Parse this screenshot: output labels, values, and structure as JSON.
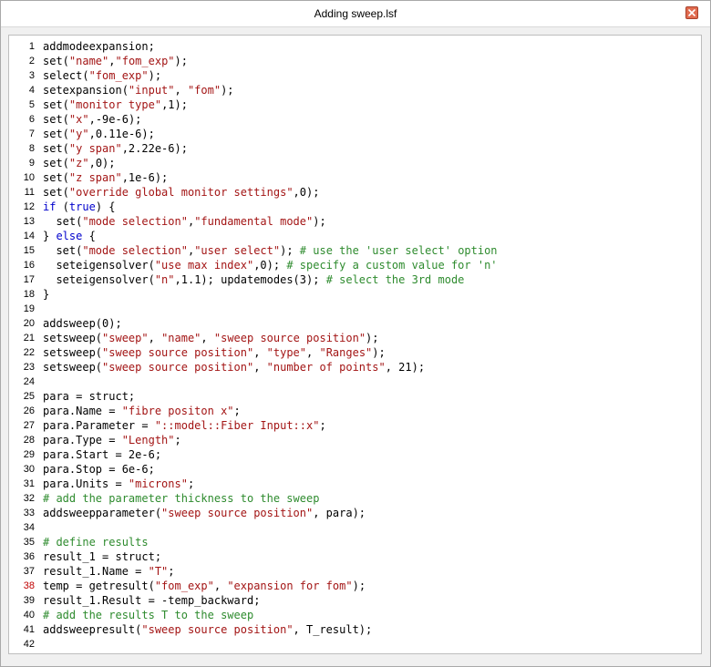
{
  "window": {
    "title": "Adding sweep.lsf"
  },
  "icons": {
    "close": "close-icon"
  },
  "colors": {
    "keyword": "#0000cc",
    "string": "#a31515",
    "comment": "#2e8b2e",
    "text": "#000000",
    "highlighted_line_number": "#c00000"
  },
  "editor": {
    "highlighted_line": 38,
    "lines": [
      {
        "n": "1",
        "tokens": [
          {
            "c": "t",
            "v": "addmodeexpansion;"
          }
        ]
      },
      {
        "n": "2",
        "tokens": [
          {
            "c": "t",
            "v": "set("
          },
          {
            "c": "str",
            "v": "\"name\""
          },
          {
            "c": "t",
            "v": ","
          },
          {
            "c": "str",
            "v": "\"fom_exp\""
          },
          {
            "c": "t",
            "v": ");"
          }
        ]
      },
      {
        "n": "3",
        "tokens": [
          {
            "c": "t",
            "v": "select("
          },
          {
            "c": "str",
            "v": "\"fom_exp\""
          },
          {
            "c": "t",
            "v": ");"
          }
        ]
      },
      {
        "n": "4",
        "tokens": [
          {
            "c": "t",
            "v": "setexpansion("
          },
          {
            "c": "str",
            "v": "\"input\""
          },
          {
            "c": "t",
            "v": ", "
          },
          {
            "c": "str",
            "v": "\"fom\""
          },
          {
            "c": "t",
            "v": ");"
          }
        ]
      },
      {
        "n": "5",
        "tokens": [
          {
            "c": "t",
            "v": "set("
          },
          {
            "c": "str",
            "v": "\"monitor type\""
          },
          {
            "c": "t",
            "v": ",1);"
          }
        ]
      },
      {
        "n": "6",
        "tokens": [
          {
            "c": "t",
            "v": "set("
          },
          {
            "c": "str",
            "v": "\"x\""
          },
          {
            "c": "t",
            "v": ",-9e-6);"
          }
        ]
      },
      {
        "n": "7",
        "tokens": [
          {
            "c": "t",
            "v": "set("
          },
          {
            "c": "str",
            "v": "\"y\""
          },
          {
            "c": "t",
            "v": ",0.11e-6);"
          }
        ]
      },
      {
        "n": "8",
        "tokens": [
          {
            "c": "t",
            "v": "set("
          },
          {
            "c": "str",
            "v": "\"y span\""
          },
          {
            "c": "t",
            "v": ",2.22e-6);"
          }
        ]
      },
      {
        "n": "9",
        "tokens": [
          {
            "c": "t",
            "v": "set("
          },
          {
            "c": "str",
            "v": "\"z\""
          },
          {
            "c": "t",
            "v": ",0);"
          }
        ]
      },
      {
        "n": "10",
        "tokens": [
          {
            "c": "t",
            "v": "set("
          },
          {
            "c": "str",
            "v": "\"z span\""
          },
          {
            "c": "t",
            "v": ",1e-6);"
          }
        ]
      },
      {
        "n": "11",
        "tokens": [
          {
            "c": "t",
            "v": "set("
          },
          {
            "c": "str",
            "v": "\"override global monitor settings\""
          },
          {
            "c": "t",
            "v": ",0);"
          }
        ]
      },
      {
        "n": "12",
        "tokens": [
          {
            "c": "kw",
            "v": "if"
          },
          {
            "c": "t",
            "v": " ("
          },
          {
            "c": "kw",
            "v": "true"
          },
          {
            "c": "t",
            "v": ") {"
          }
        ]
      },
      {
        "n": "13",
        "tokens": [
          {
            "c": "t",
            "v": "  set("
          },
          {
            "c": "str",
            "v": "\"mode selection\""
          },
          {
            "c": "t",
            "v": ","
          },
          {
            "c": "str",
            "v": "\"fundamental mode\""
          },
          {
            "c": "t",
            "v": ");"
          }
        ]
      },
      {
        "n": "14",
        "tokens": [
          {
            "c": "t",
            "v": "} "
          },
          {
            "c": "kw",
            "v": "else"
          },
          {
            "c": "t",
            "v": " {"
          }
        ]
      },
      {
        "n": "15",
        "tokens": [
          {
            "c": "t",
            "v": "  set("
          },
          {
            "c": "str",
            "v": "\"mode selection\""
          },
          {
            "c": "t",
            "v": ","
          },
          {
            "c": "str",
            "v": "\"user select\""
          },
          {
            "c": "t",
            "v": "); "
          },
          {
            "c": "cm",
            "v": "# use the 'user select' option"
          }
        ]
      },
      {
        "n": "16",
        "tokens": [
          {
            "c": "t",
            "v": "  seteigensolver("
          },
          {
            "c": "str",
            "v": "\"use max index\""
          },
          {
            "c": "t",
            "v": ",0); "
          },
          {
            "c": "cm",
            "v": "# specify a custom value for 'n'"
          }
        ]
      },
      {
        "n": "17",
        "tokens": [
          {
            "c": "t",
            "v": "  seteigensolver("
          },
          {
            "c": "str",
            "v": "\"n\""
          },
          {
            "c": "t",
            "v": ",1.1); updatemodes(3); "
          },
          {
            "c": "cm",
            "v": "# select the 3rd mode"
          }
        ]
      },
      {
        "n": "18",
        "tokens": [
          {
            "c": "t",
            "v": "}"
          }
        ]
      },
      {
        "n": "19",
        "tokens": []
      },
      {
        "n": "20",
        "tokens": [
          {
            "c": "t",
            "v": "addsweep(0);"
          }
        ]
      },
      {
        "n": "21",
        "tokens": [
          {
            "c": "t",
            "v": "setsweep("
          },
          {
            "c": "str",
            "v": "\"sweep\""
          },
          {
            "c": "t",
            "v": ", "
          },
          {
            "c": "str",
            "v": "\"name\""
          },
          {
            "c": "t",
            "v": ", "
          },
          {
            "c": "str",
            "v": "\"sweep source position\""
          },
          {
            "c": "t",
            "v": ");"
          }
        ]
      },
      {
        "n": "22",
        "tokens": [
          {
            "c": "t",
            "v": "setsweep("
          },
          {
            "c": "str",
            "v": "\"sweep source position\""
          },
          {
            "c": "t",
            "v": ", "
          },
          {
            "c": "str",
            "v": "\"type\""
          },
          {
            "c": "t",
            "v": ", "
          },
          {
            "c": "str",
            "v": "\"Ranges\""
          },
          {
            "c": "t",
            "v": ");"
          }
        ]
      },
      {
        "n": "23",
        "tokens": [
          {
            "c": "t",
            "v": "setsweep("
          },
          {
            "c": "str",
            "v": "\"sweep source position\""
          },
          {
            "c": "t",
            "v": ", "
          },
          {
            "c": "str",
            "v": "\"number of points\""
          },
          {
            "c": "t",
            "v": ", 21);"
          }
        ]
      },
      {
        "n": "24",
        "tokens": []
      },
      {
        "n": "25",
        "tokens": [
          {
            "c": "t",
            "v": "para = struct;"
          }
        ]
      },
      {
        "n": "26",
        "tokens": [
          {
            "c": "t",
            "v": "para.Name = "
          },
          {
            "c": "str",
            "v": "\"fibre positon x\""
          },
          {
            "c": "t",
            "v": ";"
          }
        ]
      },
      {
        "n": "27",
        "tokens": [
          {
            "c": "t",
            "v": "para.Parameter = "
          },
          {
            "c": "str",
            "v": "\"::model::Fiber Input::x\""
          },
          {
            "c": "t",
            "v": ";"
          }
        ]
      },
      {
        "n": "28",
        "tokens": [
          {
            "c": "t",
            "v": "para.Type = "
          },
          {
            "c": "str",
            "v": "\"Length\""
          },
          {
            "c": "t",
            "v": ";"
          }
        ]
      },
      {
        "n": "29",
        "tokens": [
          {
            "c": "t",
            "v": "para.Start = 2e-6;"
          }
        ]
      },
      {
        "n": "30",
        "tokens": [
          {
            "c": "t",
            "v": "para.Stop = 6e-6;"
          }
        ]
      },
      {
        "n": "31",
        "tokens": [
          {
            "c": "t",
            "v": "para.Units = "
          },
          {
            "c": "str",
            "v": "\"microns\""
          },
          {
            "c": "t",
            "v": ";"
          }
        ]
      },
      {
        "n": "32",
        "tokens": [
          {
            "c": "cm",
            "v": "# add the parameter thickness to the sweep"
          }
        ]
      },
      {
        "n": "33",
        "tokens": [
          {
            "c": "t",
            "v": "addsweepparameter("
          },
          {
            "c": "str",
            "v": "\"sweep source position\""
          },
          {
            "c": "t",
            "v": ", para);"
          }
        ]
      },
      {
        "n": "34",
        "tokens": []
      },
      {
        "n": "35",
        "tokens": [
          {
            "c": "cm",
            "v": "# define results"
          }
        ]
      },
      {
        "n": "36",
        "tokens": [
          {
            "c": "t",
            "v": "result_1 = struct;"
          }
        ]
      },
      {
        "n": "37",
        "tokens": [
          {
            "c": "t",
            "v": "result_1.Name = "
          },
          {
            "c": "str",
            "v": "\"T\""
          },
          {
            "c": "t",
            "v": ";"
          }
        ]
      },
      {
        "n": "38",
        "tokens": [
          {
            "c": "t",
            "v": "temp = getresult("
          },
          {
            "c": "str",
            "v": "\"fom_exp\""
          },
          {
            "c": "t",
            "v": ", "
          },
          {
            "c": "str",
            "v": "\"expansion for fom\""
          },
          {
            "c": "t",
            "v": ");"
          }
        ]
      },
      {
        "n": "39",
        "tokens": [
          {
            "c": "t",
            "v": "result_1.Result = -temp_backward;"
          }
        ]
      },
      {
        "n": "40",
        "tokens": [
          {
            "c": "cm",
            "v": "# add the results T to the sweep"
          }
        ]
      },
      {
        "n": "41",
        "tokens": [
          {
            "c": "t",
            "v": "addsweepresult("
          },
          {
            "c": "str",
            "v": "\"sweep source position\""
          },
          {
            "c": "t",
            "v": ", T_result);"
          }
        ]
      },
      {
        "n": "42",
        "tokens": []
      }
    ]
  }
}
